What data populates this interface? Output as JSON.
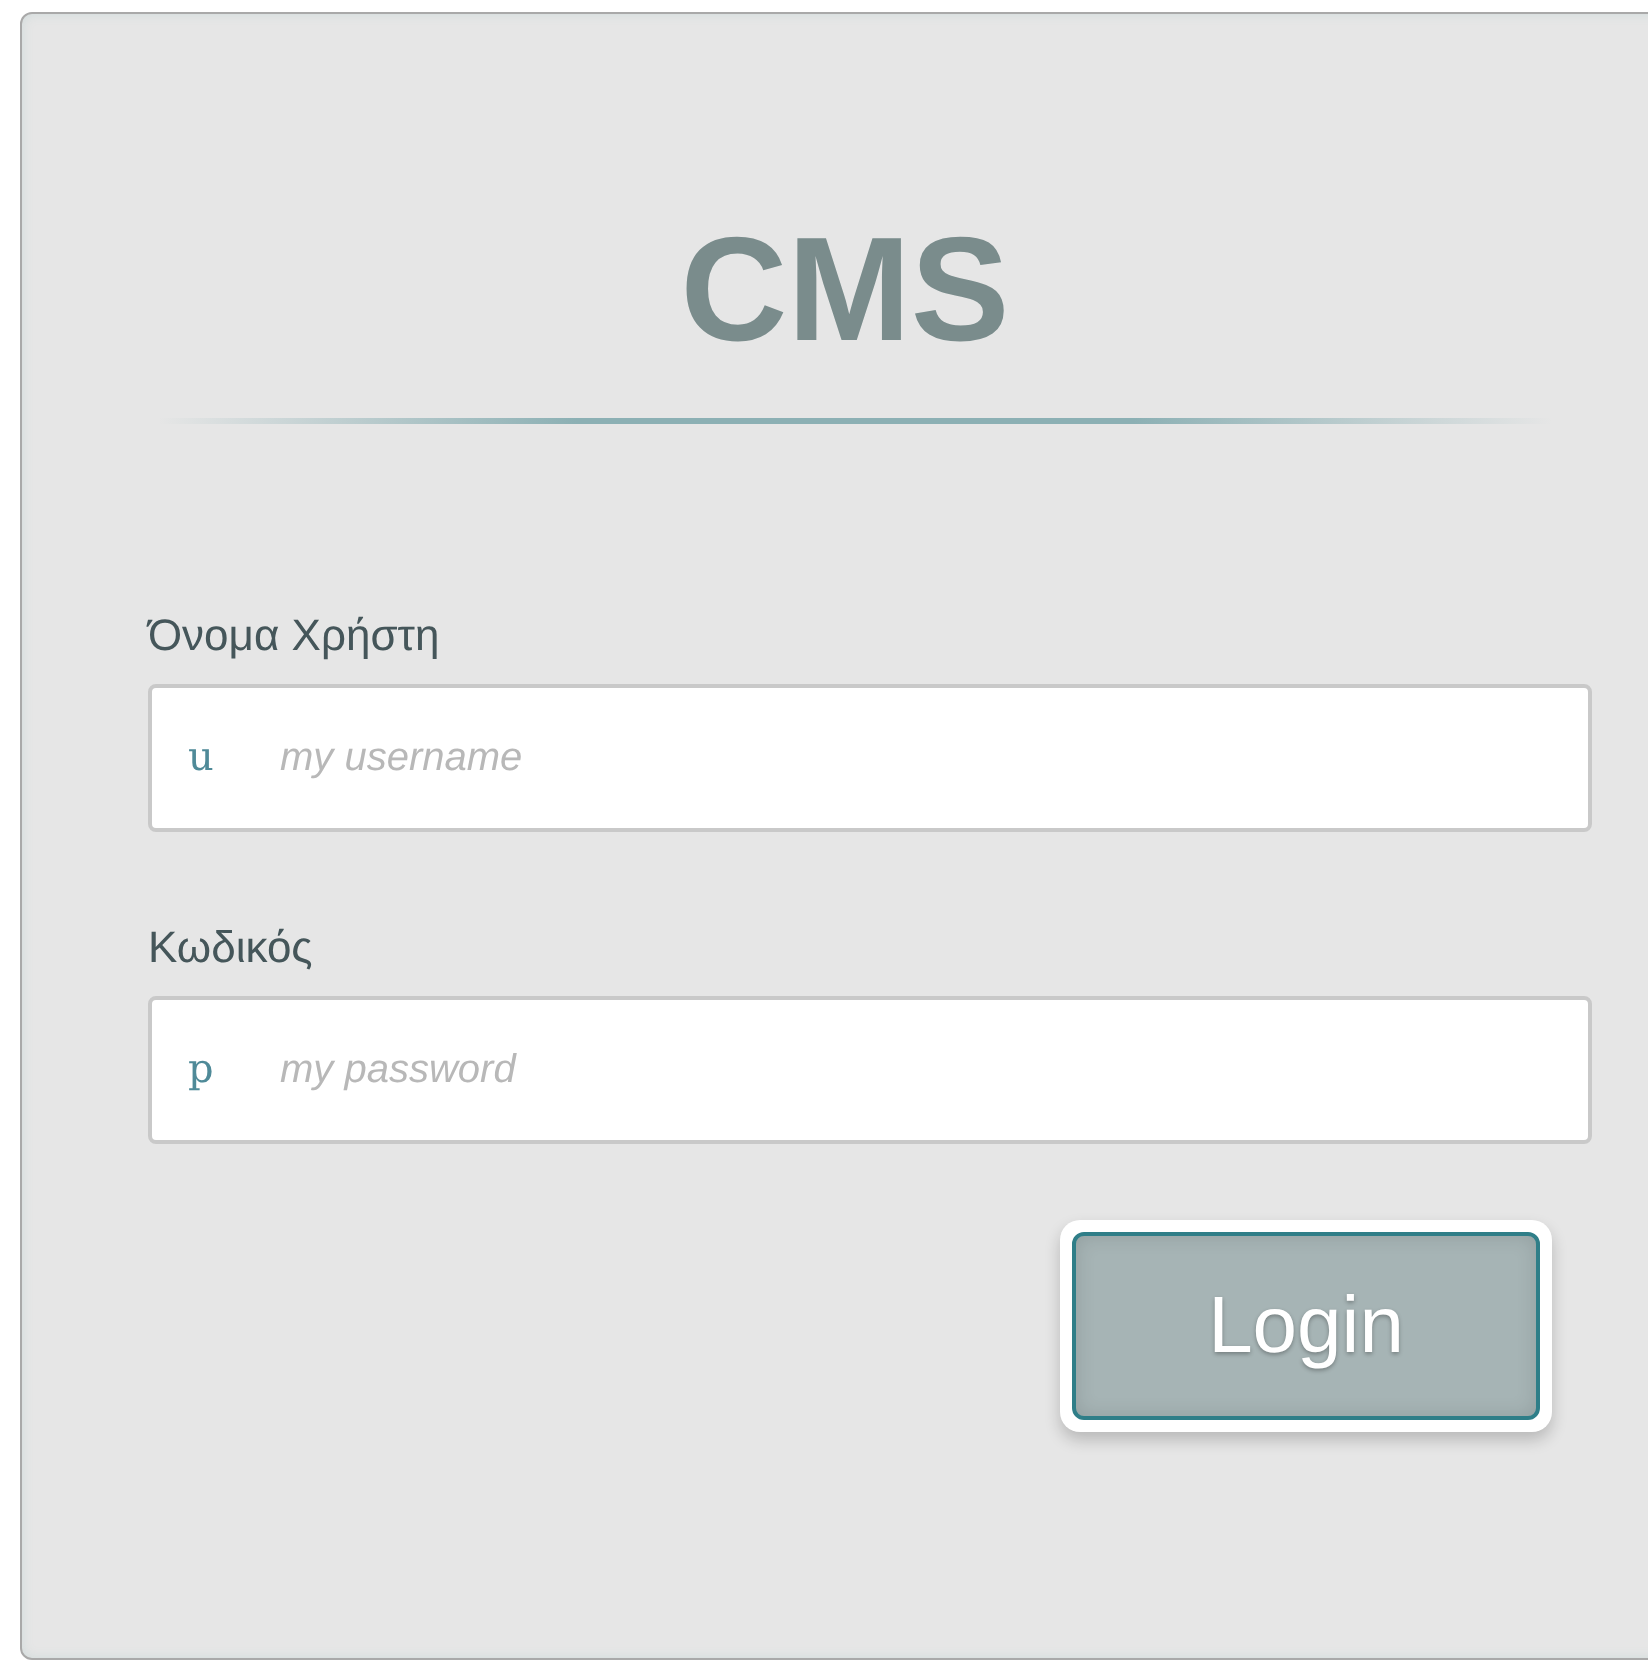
{
  "title": "CMS",
  "fields": [
    {
      "label": "Όνομα Χρήστη",
      "icon": "u",
      "placeholder": "my username"
    },
    {
      "label": "Κωδικός",
      "icon": "p",
      "placeholder": "my password"
    }
  ],
  "button": "Login"
}
